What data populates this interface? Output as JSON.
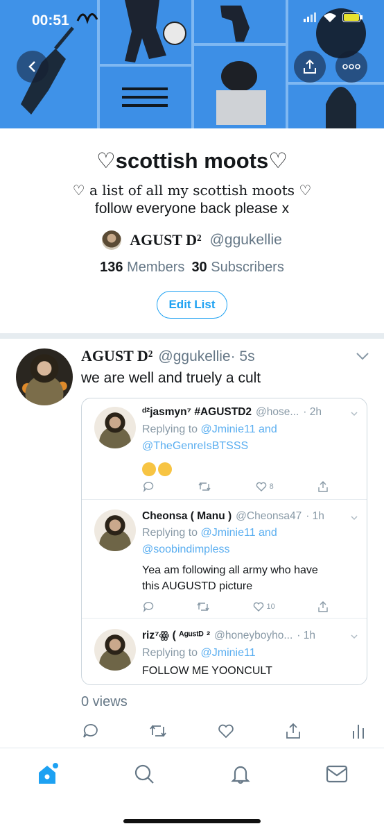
{
  "status_bar": {
    "time": "00:51"
  },
  "list": {
    "title": "♡scottish moots♡",
    "description_line1": "♡ a list of all my scottish moots ♡",
    "description_line2": "follow everyone back please x",
    "owner_name": "AGUST D²",
    "owner_handle": "@ggukellie",
    "members_count": "136",
    "members_label": "Members",
    "subscribers_count": "30",
    "subscribers_label": "Subscribers",
    "edit_label": "Edit List"
  },
  "tweet": {
    "name": "AGUST D²",
    "handle": "@ggukellie",
    "time": "· 5s",
    "text": "we are well and truely a cult",
    "views": "0 views"
  },
  "quoted": [
    {
      "name": "ᵈ²jasmyn⁷ #AGUSTD2",
      "handle": "@hose...",
      "time": "· 2h",
      "reply_prefix": "Replying to",
      "reply_to_line1": "@Jminie11 and",
      "reply_to_line2": "@TheGenreIsBTSSS",
      "body": "",
      "likes": "8"
    },
    {
      "name": "Cheonsa ( Manu )",
      "handle": "@Cheonsa47",
      "time": "· 1h",
      "reply_prefix": "Replying to",
      "reply_to_line1": "@Jminie11 and",
      "reply_to_line2": "@soobindimpless",
      "body_line1": "Yea am following all army who have",
      "body_line2": "this AUGUSTD picture",
      "likes": "10"
    },
    {
      "name": "riz⁷ꙮ ( ᴬᵍᵘˢᵗᴰ ²",
      "handle": "@honeyboyho...",
      "time": "· 1h",
      "reply_prefix": "Replying to",
      "reply_to_line1": "@Jminie11",
      "body_line1": "FOLLOW ME YOONCULT"
    }
  ],
  "colors": {
    "accent": "#1da1f2",
    "banner": "#3d8fe6",
    "muted": "#657786"
  },
  "icons": [
    "back-arrow-icon",
    "share-icon",
    "more-icon",
    "reply-icon",
    "retweet-icon",
    "like-icon",
    "analytics-icon",
    "home-icon",
    "search-icon",
    "notifications-icon",
    "messages-icon"
  ]
}
